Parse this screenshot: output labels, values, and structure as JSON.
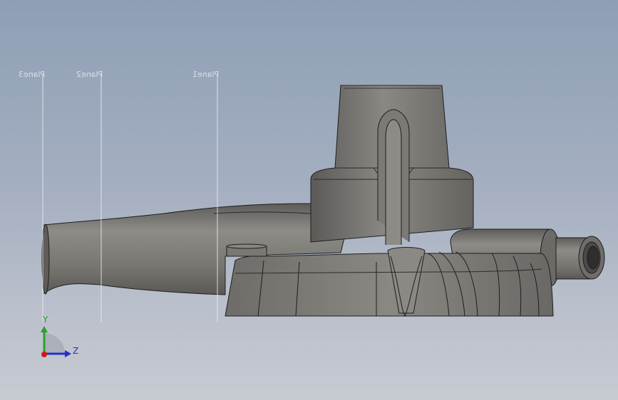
{
  "planes": [
    {
      "name": "Plane3"
    },
    {
      "name": "Plane2"
    },
    {
      "name": "Plane1"
    }
  ],
  "triad": {
    "y_label": "Y",
    "z_label": "Z",
    "colors": {
      "y": "#2aa02a",
      "z": "#2430c8",
      "origin": "#d01818"
    }
  },
  "colors": {
    "background_top": "#8e9fb5",
    "background_bottom": "#c7cad1",
    "part_body": "#76746f",
    "part_edges": "#1e1e1e"
  }
}
